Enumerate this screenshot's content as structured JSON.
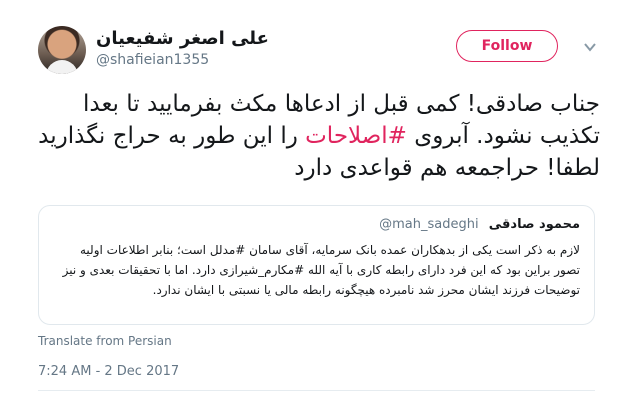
{
  "author": {
    "name": "علی اصغر شفیعیان",
    "handle": "@shafieian1355"
  },
  "follow_label": "Follow",
  "tweet": {
    "text_before": "جناب صادقی! کمی قبل از ادعاها مکث بفرمایید تا بعدا تکذیب نشود. آبروی ",
    "hashtag": "#اصلاحات",
    "text_after": " را این طور به حراج نگذارید لطفا! حراجمعه هم قواعدی دارد"
  },
  "quoted_tweet": {
    "name": "محمود صادقی",
    "handle": "@mah_sadeghi",
    "text": "لازم به ذکر است یکی از بدهکاران عمده بانک سرمایه، آقای سامان #مدلل است؛ بنابر اطلاعات اولیه تصور براین بود که این فرد دارای رابطه کاری با آیه الله #مکارم_شیرازی دارد. اما با تحقیقات بعدی و نیز توضیحات فرزند ایشان محرز شد نامبرده هیچگونه رابطه مالی یا نسبتی با ایشان ندارد."
  },
  "translate_label": "Translate from Persian",
  "timestamp": "7:24 AM - 2 Dec 2017",
  "colors": {
    "accent": "#e0245e",
    "muted": "#657786",
    "border": "#e1e8ed"
  }
}
